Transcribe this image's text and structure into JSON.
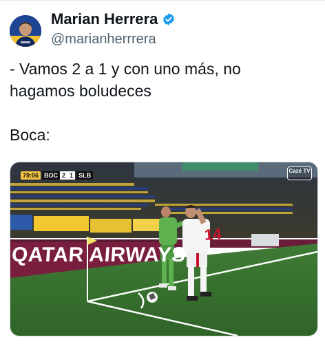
{
  "tweet": {
    "author": {
      "display_name": "Marian Herrera",
      "handle": "@marianherrrera",
      "verified": true,
      "verified_color": "#1d9bf0"
    },
    "text": "- Vamos 2 a 1 y con uno más, no\nhagamos boludeces\n\nBoca:"
  },
  "media": {
    "scorebug": {
      "clock": "79:06",
      "home_team": "BOC",
      "home_score": "2",
      "away_score": "1",
      "away_team": "SLB"
    },
    "broadcaster_logo": "Cazé TV",
    "ad_board_text": "QATAR AIRWAYS",
    "player_number": "14"
  }
}
